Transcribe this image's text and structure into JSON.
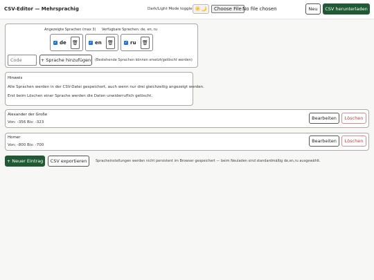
{
  "header": {
    "title": "CSV-Editor — Mehrsprachig",
    "theme_label": "Dark/Light Mode toggle",
    "theme_icon": "☀️🌙",
    "file_button": "Choose File",
    "file_status": "No file chosen",
    "new_label": "Neu",
    "download_label": "CSV herunterladen"
  },
  "languages": {
    "shown_label": "Angezeigte Sprachen (max 3)",
    "available_label": "Verfügbare Sprachen: de, en, ru",
    "items": [
      {
        "code": "de",
        "checked": true
      },
      {
        "code": "en",
        "checked": true
      },
      {
        "code": "ru",
        "checked": true
      }
    ],
    "code_placeholder": "Code",
    "add_label": "+ Sprache hinzufügen",
    "add_hint": "(Bestehende Sprachen können ersetzt/gelöscht werden)"
  },
  "notice": {
    "title": "Hinweis",
    "line1": "Alle Sprachen werden in der CSV-Datei gespeichert, auch wenn nur drei gleichzeitig angezeigt werden.",
    "line2": "Erst beim Löschen einer Sprache werden die Daten unwiderruflich gelöscht."
  },
  "entries": [
    {
      "name": "Alexander der Große",
      "meta": "Von: -356 Bis: -323",
      "edit": "Bearbeiten",
      "delete": "Löschen"
    },
    {
      "name": "Homer",
      "meta": "Von: -800 Bis: -700",
      "edit": "Bearbeiten",
      "delete": "Löschen"
    }
  ],
  "footer": {
    "new_entry": "+ Neuer Eintrag",
    "export": "CSV exportieren",
    "note": "Spracheinstellungen werden nicht persistent im Browser gespeichert — beim Neuladen sind standardmäßig de,en,ru ausgewählt."
  },
  "colors": {
    "accent": "#1f5a34",
    "danger": "#c43d3d",
    "checkbox": "#1a73e8"
  }
}
